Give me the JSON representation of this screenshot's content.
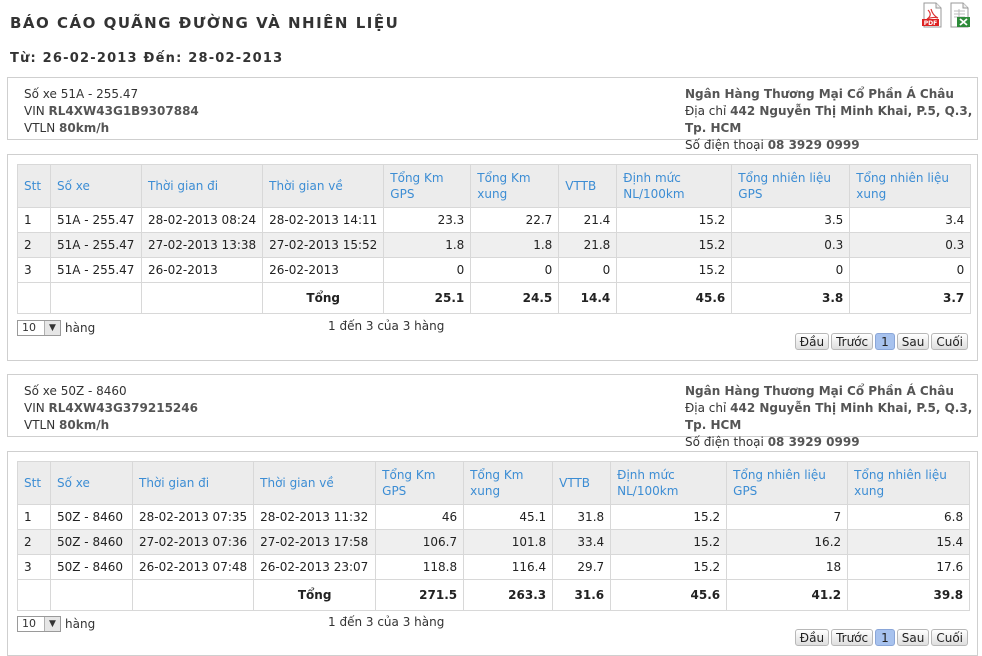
{
  "report": {
    "title": "BÁO CÁO QUÃNG ĐƯỜNG VÀ NHIÊN LIỆU",
    "date_range": "Từ: 26-02-2013 Đến: 28-02-2013"
  },
  "export": {
    "pdf_icon": "pdf-icon",
    "excel_icon": "excel-icon"
  },
  "columns": [
    "Stt",
    "Số xe",
    "Thời gian đi",
    "Thời gian về",
    "Tổng Km GPS",
    "Tổng Km xung",
    "VTTB",
    "Định mức NL/100km",
    "Tổng nhiên liệu GPS",
    "Tổng nhiên liệu xung"
  ],
  "pager": {
    "rows_per_page": "10",
    "rows_label": "hàng",
    "first": "Đầu",
    "prev": "Trước",
    "page": "1",
    "next": "Sau",
    "last": "Cuối"
  },
  "vehicles": [
    {
      "plate_line": "Số xe 51A - 255.47",
      "vin_label": "VIN ",
      "vin": "RL4XW43G1B9307884",
      "vtln_label": "VTLN ",
      "vtln": "80km/h",
      "company": "Ngân Hàng Thương Mại Cổ Phần Á Châu",
      "address_label": "Địa chỉ ",
      "address": "442 Nguyễn Thị Minh Khai, P.5, Q.3, Tp. HCM",
      "phone_label": "Số điện thoại ",
      "phone": "08 3929 0999",
      "rows": [
        [
          "1",
          "51A - 255.47",
          "28-02-2013 08:24",
          "28-02-2013 14:11",
          "23.3",
          "22.7",
          "21.4",
          "15.2",
          "3.5",
          "3.4"
        ],
        [
          "2",
          "51A - 255.47",
          "27-02-2013 13:38",
          "27-02-2013 15:52",
          "1.8",
          "1.8",
          "21.8",
          "15.2",
          "0.3",
          "0.3"
        ],
        [
          "3",
          "51A - 255.47",
          "26-02-2013",
          "26-02-2013",
          "0",
          "0",
          "0",
          "15.2",
          "0",
          "0"
        ]
      ],
      "total": {
        "label": "Tổng",
        "values": [
          "25.1",
          "24.5",
          "14.4",
          "45.6",
          "3.8",
          "3.7"
        ]
      },
      "count_text": "1 đến 3 của 3 hàng"
    },
    {
      "plate_line": "Số xe 50Z - 8460",
      "vin_label": "VIN ",
      "vin": "RL4XW43G379215246",
      "vtln_label": "VTLN ",
      "vtln": "80km/h",
      "company": "Ngân Hàng Thương Mại Cổ Phần Á Châu",
      "address_label": "Địa chỉ ",
      "address": "442 Nguyễn Thị Minh Khai, P.5, Q.3, Tp. HCM",
      "phone_label": "Số điện thoại ",
      "phone": "08 3929 0999",
      "rows": [
        [
          "1",
          "50Z - 8460",
          "28-02-2013 07:35",
          "28-02-2013 11:32",
          "46",
          "45.1",
          "31.8",
          "15.2",
          "7",
          "6.8"
        ],
        [
          "2",
          "50Z - 8460",
          "27-02-2013 07:36",
          "27-02-2013 17:58",
          "106.7",
          "101.8",
          "33.4",
          "15.2",
          "16.2",
          "15.4"
        ],
        [
          "3",
          "50Z - 8460",
          "26-02-2013 07:48",
          "26-02-2013 23:07",
          "118.8",
          "116.4",
          "29.7",
          "15.2",
          "18",
          "17.6"
        ]
      ],
      "total": {
        "label": "Tổng",
        "values": [
          "271.5",
          "263.3",
          "31.6",
          "45.6",
          "41.2",
          "39.8"
        ]
      },
      "count_text": "1 đến 3 của 3 hàng"
    }
  ]
}
